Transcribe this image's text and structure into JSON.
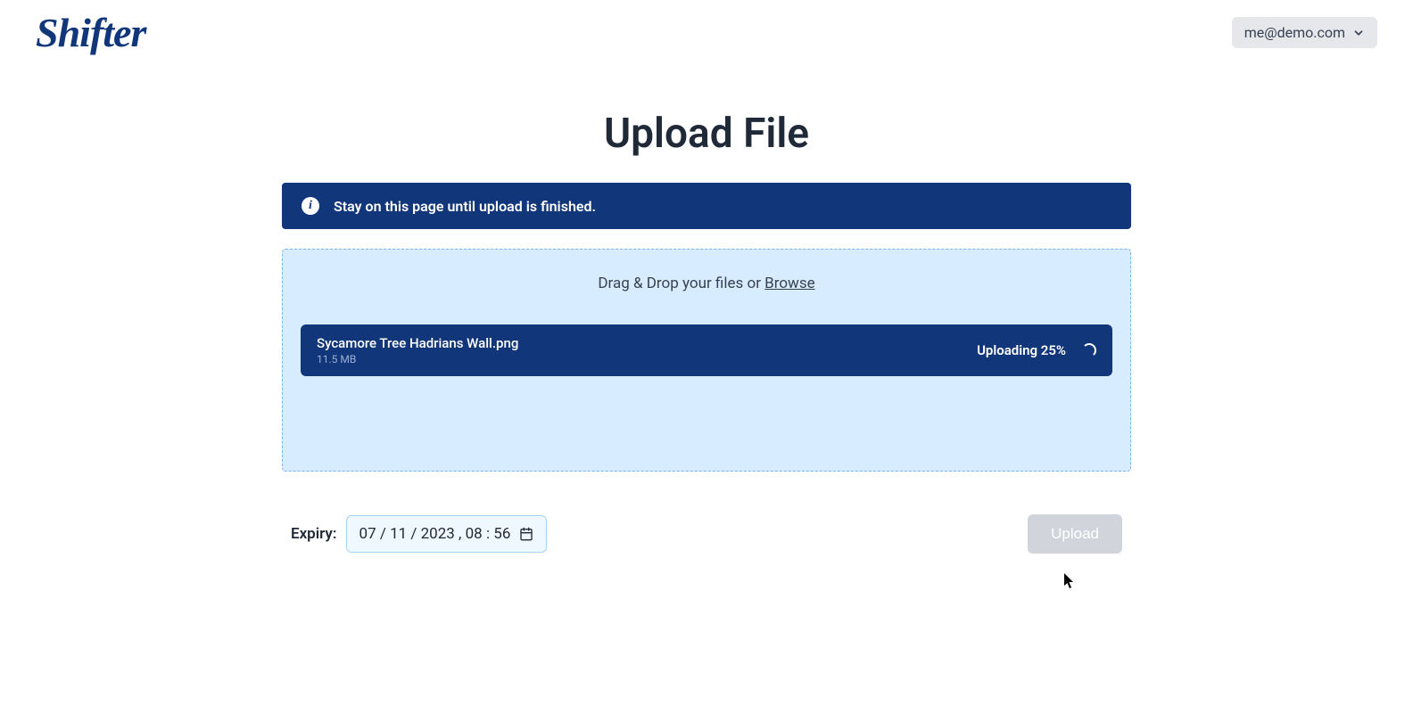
{
  "header": {
    "logo_text": "Shifter",
    "user_email": "me@demo.com"
  },
  "page": {
    "title": "Upload File"
  },
  "banner": {
    "text": "Stay on this page until upload is finished."
  },
  "dropzone": {
    "prefix_text": "Drag & Drop your files or ",
    "browse_text": "Browse"
  },
  "file": {
    "name": "Sycamore Tree Hadrians Wall.png",
    "size": "11.5 MB",
    "status": "Uploading 25%"
  },
  "expiry": {
    "label": "Expiry:",
    "value": "07 / 11 / 2023 ,  08 : 56"
  },
  "actions": {
    "upload_label": "Upload"
  }
}
